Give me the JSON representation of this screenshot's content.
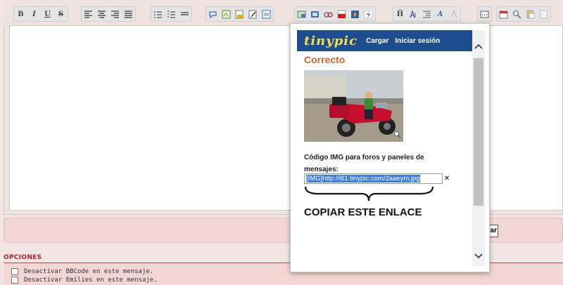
{
  "toolbar": {
    "groups": [
      [
        "B",
        "I",
        "U",
        "S"
      ],
      [
        "align-left",
        "align-center",
        "align-right",
        "justify"
      ],
      [
        "list-unordered",
        "list-ordered",
        "outdent"
      ],
      [
        "smiley",
        "image-link",
        "insert-image",
        "edit",
        "document"
      ],
      [
        "image-upload",
        "gallery",
        "link",
        "youtube",
        "fire",
        "flash"
      ],
      [
        "heading",
        "font-size",
        "indent",
        "A",
        "color"
      ],
      [
        "more"
      ],
      [
        "calendar",
        "search",
        "paste",
        "page"
      ]
    ]
  },
  "submit": {
    "label": "ar"
  },
  "options": {
    "title": "OPCIONES",
    "items": [
      "Desactivar BBCode en este mensaje.",
      "Desactivar Emilies en este mensaje."
    ]
  },
  "popup": {
    "logo": "tinypic",
    "links": [
      "Cargar",
      "Iniciar sesión"
    ],
    "status": "Correcto",
    "code_label": "Código IMG para foros y paneles de mensajes:",
    "code_value": "[IMG]http://i61.tinypic.com/2aaeym.jpg",
    "annotation": "COPIAR ESTE ENLACE",
    "colors": {
      "header_bg": "#1e4d8f",
      "logo": "#f2e14a",
      "status": "#d0662e",
      "selection": "#3b7de0"
    }
  }
}
